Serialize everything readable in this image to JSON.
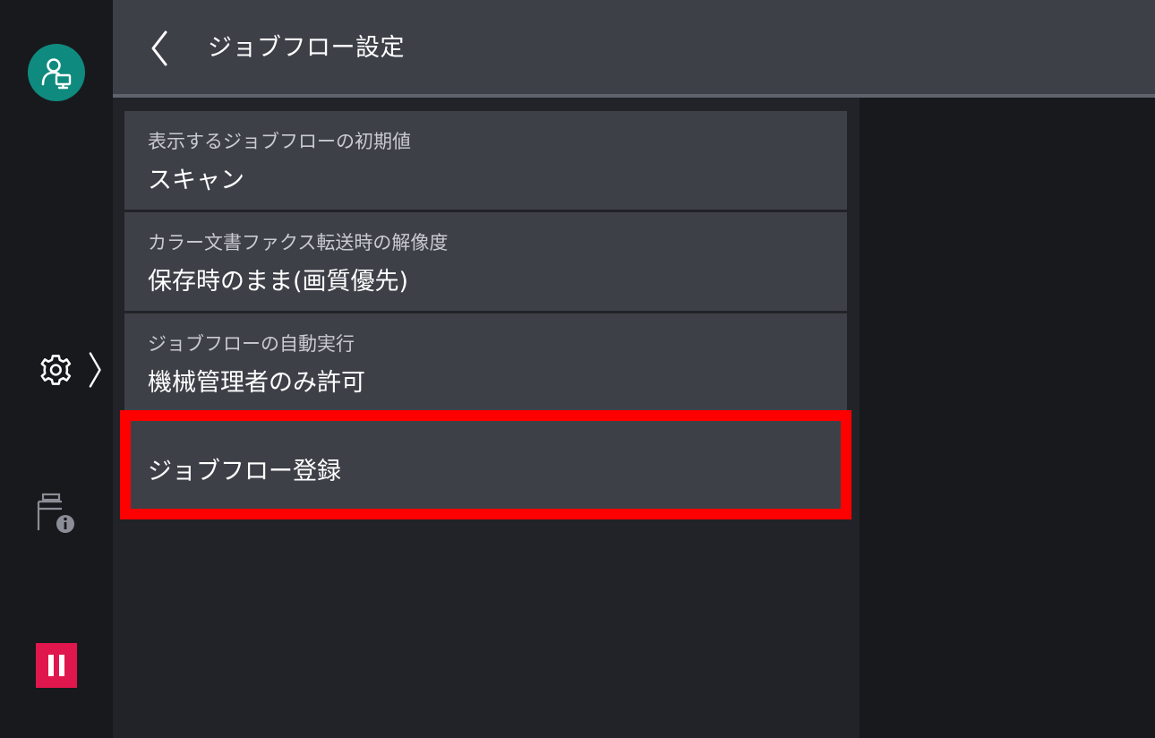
{
  "header": {
    "title": "ジョブフロー設定"
  },
  "sidebar": {
    "items": [
      {
        "name": "user-account",
        "icon": "user-monitor-icon"
      },
      {
        "name": "settings",
        "icon": "gear-icon"
      },
      {
        "name": "machine-info",
        "icon": "printer-info-icon"
      },
      {
        "name": "stop",
        "icon": "pause-icon"
      }
    ]
  },
  "settings_list": [
    {
      "label": "表示するジョブフローの初期値",
      "value": "スキャン"
    },
    {
      "label": "カラー文書ファクス転送時の解像度",
      "value": "保存時のまま(画質優先)"
    },
    {
      "label": "ジョブフローの自動実行",
      "value": "機械管理者のみ許可"
    },
    {
      "label": "ジョブフロー登録"
    }
  ],
  "colors": {
    "accent_teal": "#0f8a7e",
    "stop_red": "#e0174d",
    "highlight_red": "#ff0000",
    "panel": "#3e4048",
    "background": "#18191d"
  }
}
